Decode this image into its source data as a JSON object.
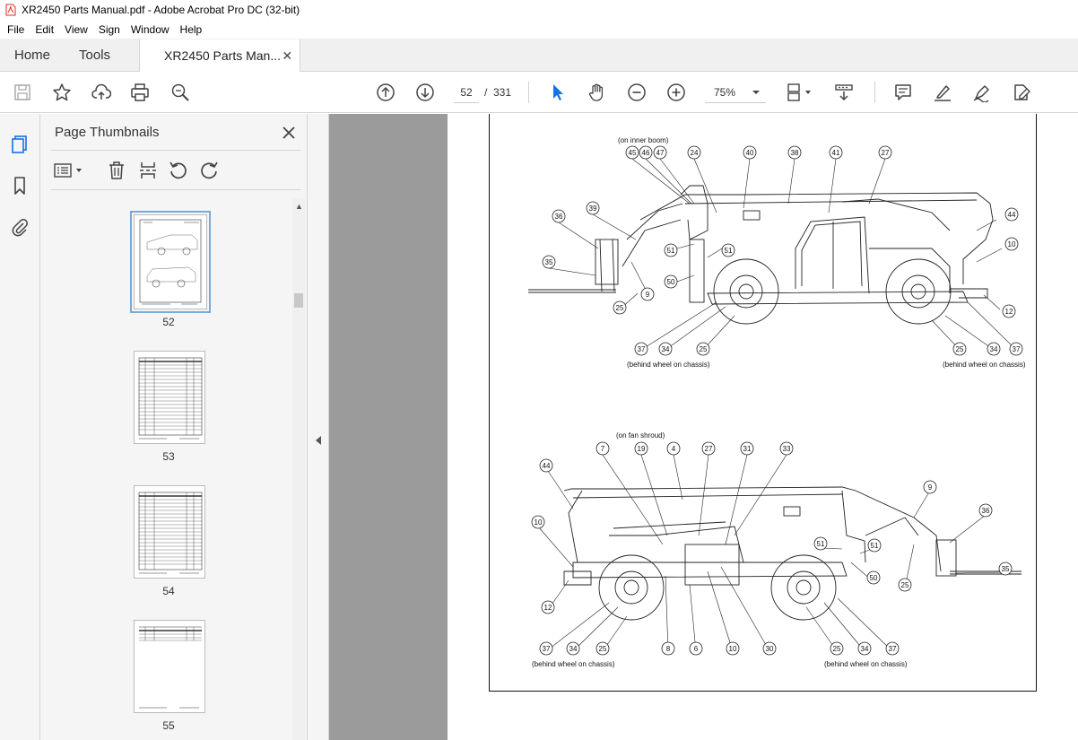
{
  "window": {
    "title": "XR2450 Parts Manual.pdf - Adobe Acrobat Pro DC (32-bit)"
  },
  "menu": [
    "File",
    "Edit",
    "View",
    "Sign",
    "Window",
    "Help"
  ],
  "tabs": {
    "home": "Home",
    "tools": "Tools",
    "document": "XR2450 Parts Man..."
  },
  "toolbar": {
    "current_page": "52",
    "separator": "/",
    "total_pages": "331",
    "zoom": "75%"
  },
  "thumbnails_panel": {
    "title": "Page Thumbnails",
    "pages": [
      {
        "label": "52",
        "selected": true
      },
      {
        "label": "53",
        "selected": false
      },
      {
        "label": "54",
        "selected": false
      },
      {
        "label": "55",
        "selected": false
      }
    ]
  },
  "document_page": {
    "top_view": {
      "note_top": "(on inner boom)",
      "note_left": "(behind wheel on chassis)",
      "note_right": "(behind wheel on chassis)",
      "callouts": [
        "45",
        "46",
        "47",
        "24",
        "40",
        "38",
        "41",
        "27",
        "36",
        "39",
        "44",
        "10",
        "51",
        "51",
        "35",
        "50",
        "9",
        "12",
        "25",
        "37",
        "34",
        "25",
        "25",
        "34",
        "37"
      ]
    },
    "bottom_view": {
      "note_top": "(on fan shroud)",
      "note_left": "(behind wheel on chassis)",
      "note_right": "(behind wheel on chassis)",
      "callouts": [
        "7",
        "19",
        "4",
        "27",
        "31",
        "33",
        "44",
        "9",
        "36",
        "10",
        "51",
        "51",
        "35",
        "50",
        "25",
        "12",
        "37",
        "34",
        "25",
        "8",
        "6",
        "10",
        "30",
        "25",
        "34",
        "37"
      ]
    }
  },
  "colors": {
    "accent_blue": "#1473e6",
    "doc_background": "#9b9b9b",
    "pdf_red": "#e0281b"
  }
}
